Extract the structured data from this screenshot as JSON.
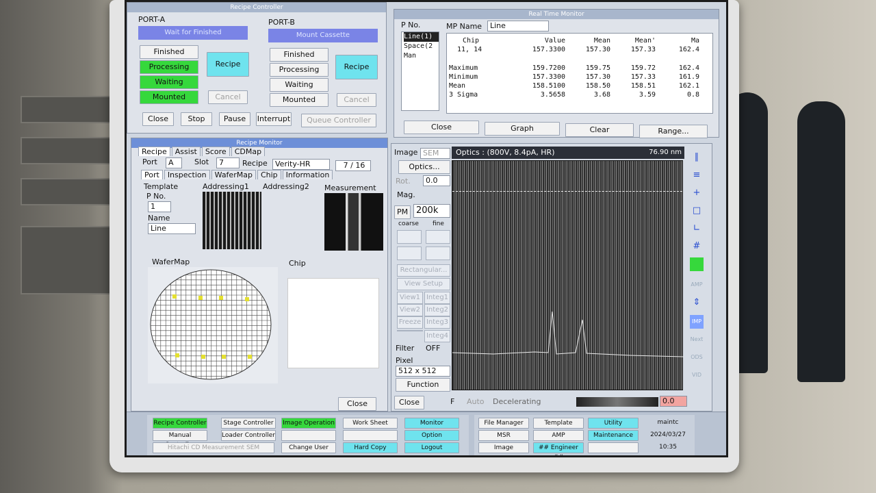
{
  "recipe_controller": {
    "title": "Recipe Controller",
    "port_a": {
      "label": "PORT-A",
      "status": "Wait for Finished",
      "finished": "Finished",
      "processing": "Processing",
      "waiting": "Waiting",
      "mounted": "Mounted",
      "recipe": "Recipe",
      "cancel": "Cancel"
    },
    "port_b": {
      "label": "PORT-B",
      "status": "Mount Cassette",
      "finished": "Finished",
      "processing": "Processing",
      "waiting": "Waiting",
      "mounted": "Mounted",
      "recipe": "Recipe",
      "cancel": "Cancel"
    },
    "close": "Close",
    "stop": "Stop",
    "pause": "Pause",
    "interrupt": "Interrupt",
    "queue": "Queue Controller"
  },
  "monitor": {
    "title": "Real Time Monitor",
    "pno": "P No.",
    "mpname": "MP Name",
    "mpvalue": "Line",
    "list": [
      "Line(1)",
      "Space(2",
      "Man"
    ],
    "headers": [
      "Chip",
      "Value",
      "Mean",
      "Mean'",
      "Ma"
    ],
    "row": [
      "11,  14",
      "157.3300",
      "157.30",
      "157.33",
      "162.4"
    ],
    "stats": [
      [
        "Maximum",
        "159.7200",
        "159.75",
        "159.72",
        "162.4"
      ],
      [
        "Minimum",
        "157.3300",
        "157.30",
        "157.33",
        "161.9"
      ],
      [
        "Mean",
        "158.5100",
        "158.50",
        "158.51",
        "162.1"
      ],
      [
        "3 Sigma",
        "3.5658",
        "3.68",
        "3.59",
        "0.8"
      ]
    ],
    "close": "Close",
    "graph": "Graph",
    "clear": "Clear",
    "range": "Range..."
  },
  "recipe_monitor": {
    "title": "Recipe Monitor",
    "tabs1": [
      "Recipe",
      "Assist",
      "Score",
      "CDMap"
    ],
    "port_label": "Port",
    "port": "A",
    "slot_label": "Slot",
    "slot": "7",
    "recipe_label": "Recipe",
    "recipe": "Verity-HR",
    "count": "7 / 16",
    "tabs2": [
      "Port",
      "Inspection",
      "WaferMap",
      "Chip",
      "Information"
    ],
    "template": "Template",
    "addr1": "Addressing1",
    "addr2": "Addressing2",
    "measurement": "Measurement",
    "pno": "P No.",
    "pno_val": "1",
    "name": "Name",
    "name_val": "Line",
    "wafermap": "WaferMap",
    "chip": "Chip",
    "close": "Close"
  },
  "image_op": {
    "image": "Image",
    "sem": "SEM",
    "optics": "Optics...",
    "rot": "Rot.",
    "rot_val": "0.0",
    "mag": "Mag.",
    "pm": "PM",
    "mag_val": "200k",
    "coarse": "coarse",
    "fine": "fine",
    "rectangular": "Rectangular...",
    "view_setup": "View Setup",
    "view1": "View1",
    "view2": "View2",
    "freeze": "Freeze",
    "integ1": "Integ1",
    "integ2": "Integ2",
    "integ3": "Integ3",
    "integ4": "Integ4",
    "filter": "Filter",
    "filter_val": "OFF",
    "pixel": "Pixel",
    "pixel_val": "512 x 512",
    "function": "Function",
    "close": "Close",
    "f": "F",
    "auto": "Auto",
    "decel": "Decelerating",
    "val": "0.0",
    "header": "Optics : (800V, 8.4pA, HR)",
    "scale": "76.90 nm",
    "side": [
      "AMP",
      "IMP",
      "Next",
      "ODS",
      "VID"
    ]
  },
  "taskbar": {
    "left": [
      [
        "Recipe Controller",
        "Stage Controller",
        "Image Operation",
        "Work Sheet",
        "Monitor"
      ],
      [
        "Manual Controller",
        "Loader Controller",
        "",
        "",
        "Option"
      ],
      [
        "Hitachi CD Measurement SEM",
        "",
        "Change User",
        "Hard Copy",
        "Logout"
      ]
    ],
    "right": [
      [
        "File Manager",
        "Template",
        "Utility",
        "maintc"
      ],
      [
        "MSR",
        "AMP",
        "Maintenance",
        "2024/03/27"
      ],
      [
        "Image",
        "## Engineer ##",
        "",
        "10:35"
      ]
    ]
  },
  "colors": {
    "green": "#36d83c",
    "cyan": "#6fe3ee",
    "active_title": "#6d8fd8"
  }
}
